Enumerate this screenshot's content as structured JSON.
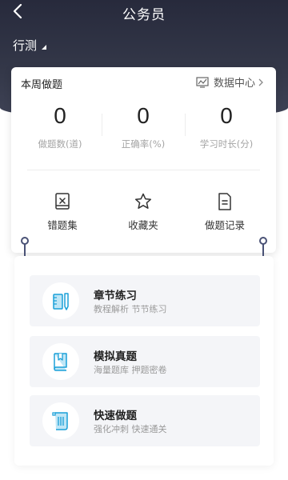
{
  "nav": {
    "title": "公务员"
  },
  "subject": {
    "label": "行测"
  },
  "weekly": {
    "title": "本周做题",
    "data_center_label": "数据中心",
    "stats": [
      {
        "value": "0",
        "label": "做题数(道)"
      },
      {
        "value": "0",
        "label": "正确率(%)"
      },
      {
        "value": "0",
        "label": "学习时长(分)"
      }
    ]
  },
  "tools": [
    {
      "label": "错题集",
      "icon": "wrong-book-icon"
    },
    {
      "label": "收藏夹",
      "icon": "star-icon"
    },
    {
      "label": "做题记录",
      "icon": "record-icon"
    }
  ],
  "modes": [
    {
      "title": "章节练习",
      "subtitle": "教程解析 节节练习",
      "icon": "pencil-ruler-icon"
    },
    {
      "title": "模拟真题",
      "subtitle": "海量题库 押题密卷",
      "icon": "book-icon"
    },
    {
      "title": "快速做题",
      "subtitle": "强化冲刺 快速通关",
      "icon": "scroll-icon"
    }
  ],
  "colors": {
    "header": "#2c2f42",
    "accent": "#1aa0d8",
    "ring": "#4a5276"
  }
}
